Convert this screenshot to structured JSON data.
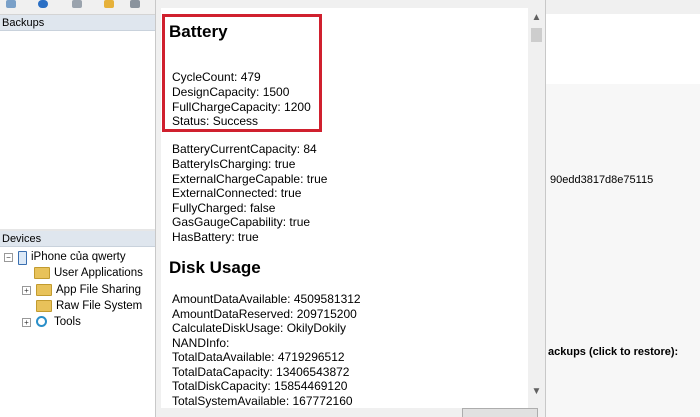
{
  "panels": {
    "backups_title": "Backups",
    "devices_title": "Devices"
  },
  "tree": {
    "device": "iPhone của qwerty",
    "items": [
      {
        "label": "User Applications"
      },
      {
        "label": "App File Sharing"
      },
      {
        "label": "Raw File System"
      },
      {
        "label": "Tools"
      }
    ]
  },
  "right": {
    "hash_fragment": "90edd3817d8e75115",
    "backups_restore": "ackups (click to restore):"
  },
  "content": {
    "battery_heading": "Battery",
    "battery_highlighted": [
      "CycleCount: 479",
      "DesignCapacity: 1500",
      "FullChargeCapacity: 1200",
      "Status: Success"
    ],
    "battery_rest": [
      "BatteryCurrentCapacity: 84",
      "BatteryIsCharging: true",
      "ExternalChargeCapable: true",
      "ExternalConnected: true",
      "FullyCharged: false",
      "GasGaugeCapability: true",
      "HasBattery: true"
    ],
    "disk_heading": "Disk Usage",
    "disk_lines": [
      "AmountDataAvailable: 4509581312",
      "AmountDataReserved: 209715200",
      "CalculateDiskUsage: OkilyDokily",
      "NANDInfo:",
      "TotalDataAvailable: 4719296512",
      "TotalDataCapacity: 13406543872",
      "TotalDiskCapacity: 15854469120",
      "TotalSystemAvailable: 167772160"
    ]
  },
  "colors": {
    "highlight": "#d0202e",
    "panel_header": "#dfe6ee"
  },
  "icons": {
    "expander": "+",
    "scroll_up": "▲",
    "scroll_down": "▼"
  }
}
